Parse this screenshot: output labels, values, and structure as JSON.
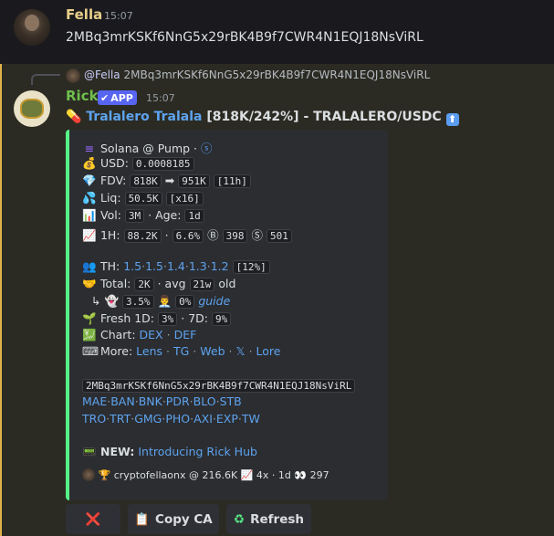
{
  "msg1": {
    "author": "Fella",
    "time": "15:07",
    "text": "2MBq3mrKSKf6NnG5x29rBK4B9f7CWR4N1EQJ18NsViRL"
  },
  "msg2": {
    "reply_mention": "@Fella",
    "reply_text": "2MBq3mrKSKf6NnG5x29rBK4B9f7CWR4N1EQJ18NsViRL",
    "author": "Rick",
    "badge": "APP",
    "time": "15:07",
    "title_link": "Tralalero Tralala",
    "title_rest": "[818K/242%] - TRALALERO/USDC"
  },
  "embed": {
    "chain": "Solana @ Pump ·",
    "usd_label": "USD:",
    "usd_value": "0.0008185",
    "fdv_label": "FDV:",
    "fdv_from": "818K",
    "fdv_to": "951K",
    "fdv_time": "[11h]",
    "liq_label": "Liq:",
    "liq_value": "50.5K",
    "liq_mult": "[x16]",
    "vol_label": "Vol:",
    "vol_value": "3M",
    "age_label": "· Age:",
    "age_value": "1d",
    "h1_label": "1H:",
    "h1_value": "88.2K",
    "h1_sep": "·",
    "h1_pct": "6.6%",
    "h1_buys": "398",
    "h1_sells": "501",
    "th_label": "TH:",
    "th_values": [
      "1.5",
      "1.5",
      "1.4",
      "1.3",
      "1.2"
    ],
    "th_total": "[12%]",
    "total_label": "Total:",
    "total_value": "2K",
    "total_avg": "· avg",
    "total_avg_value": "21w",
    "total_old": "old",
    "sub_pct1": "3.5%",
    "sub_pct2": "0%",
    "sub_guide": "guide",
    "fresh_label": "Fresh 1D:",
    "fresh_1d": "3%",
    "fresh_7d_label": "· 7D:",
    "fresh_7d": "9%",
    "chart_label": "Chart:",
    "chart_links": [
      "DEX",
      "DEF"
    ],
    "more_label": "More:",
    "more_links": [
      "Lens",
      "TG",
      "Web",
      "𝕏",
      "Lore"
    ],
    "ca": "2MBq3mrKSKf6NnG5x29rBK4B9f7CWR4N1EQJ18NsViRL",
    "links_row1": [
      "MAE",
      "BAN",
      "BNK",
      "PDR",
      "BLO",
      "STB"
    ],
    "links_row2": [
      "TRO",
      "TRT",
      "GMG",
      "PHO",
      "AXI",
      "EXP",
      "TW"
    ],
    "new_label": "NEW:",
    "new_link": "Introducing Rick Hub",
    "footer": "cryptofellaonx @ 216.6K",
    "footer_mult": "4x · 1d",
    "footer_views": "297"
  },
  "buttons": {
    "cancel": "❌",
    "copy": "Copy CA",
    "refresh": "Refresh"
  },
  "colors": {
    "accent_blue": "#5865f2",
    "link": "#5ea3ee",
    "embed_bar": "#57f287",
    "rick_name": "#6fbf4e"
  }
}
